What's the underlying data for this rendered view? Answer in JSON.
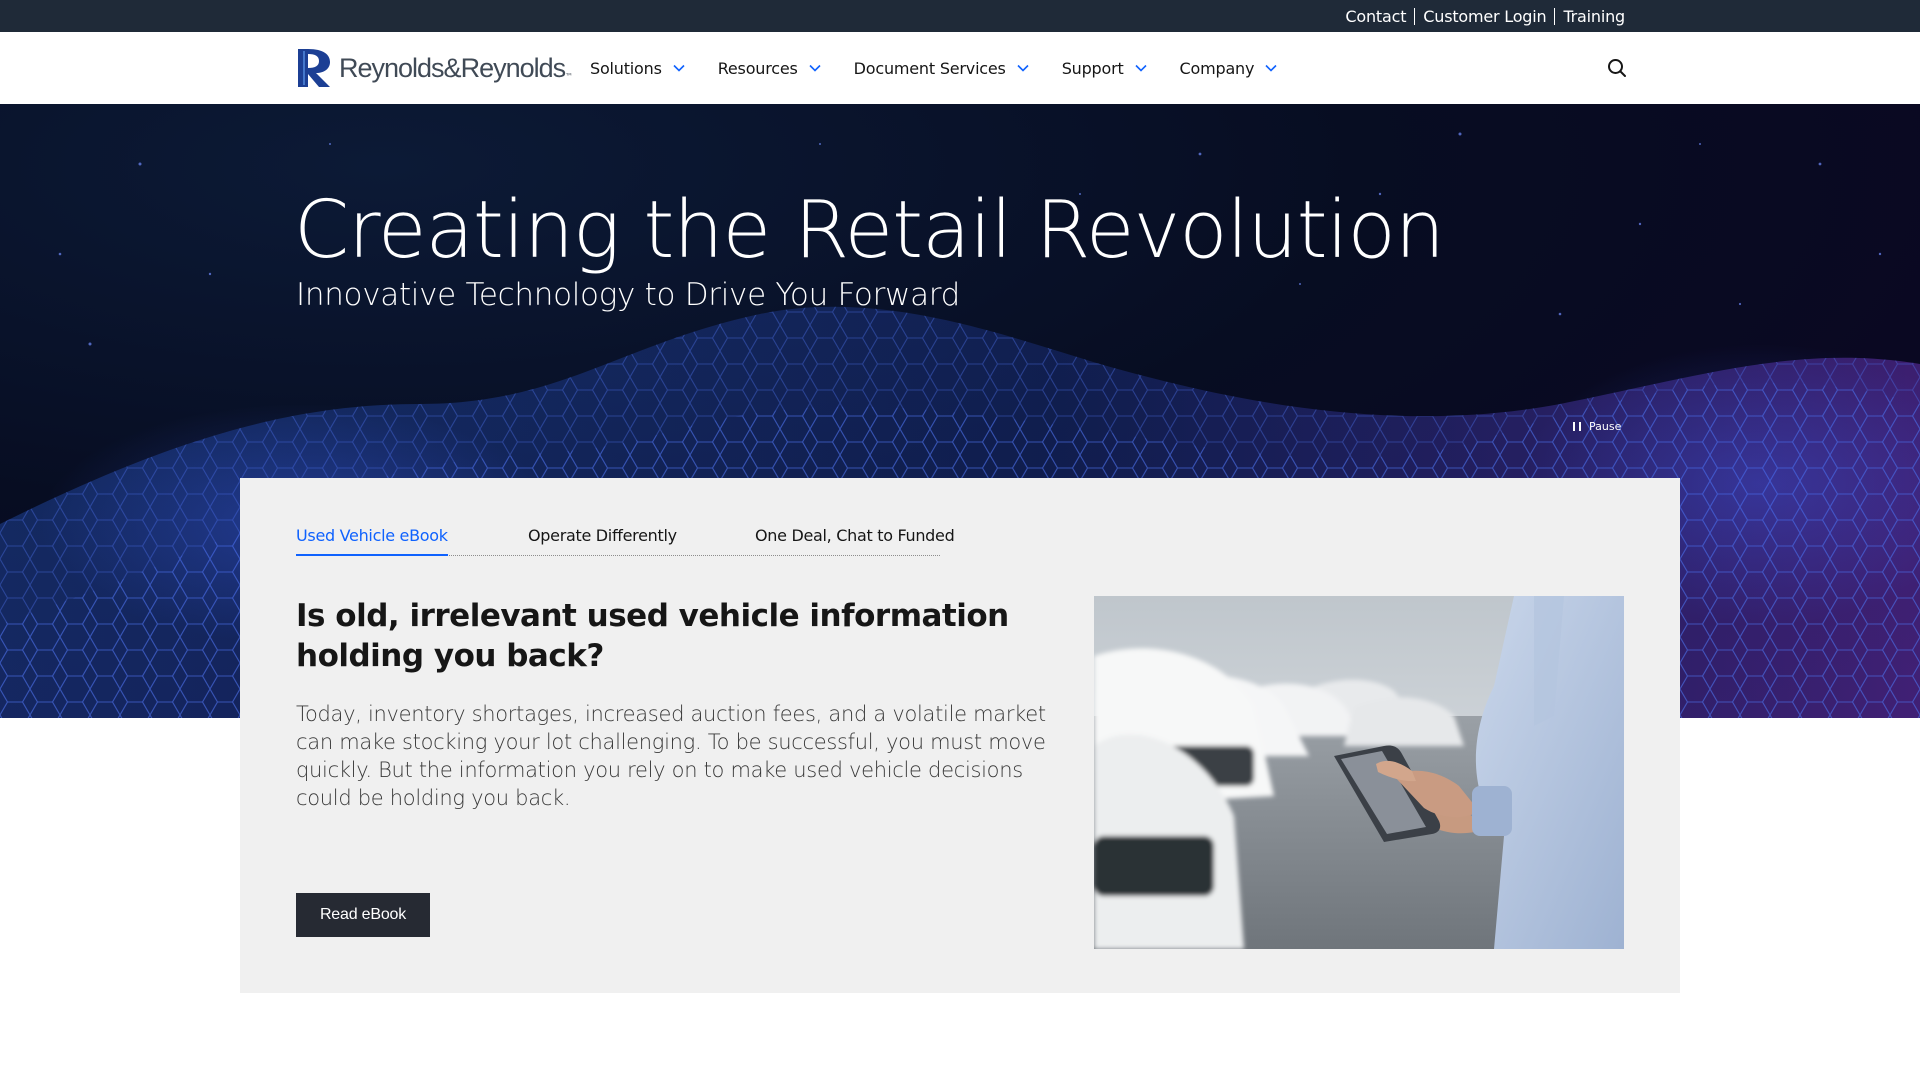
{
  "utility_nav": {
    "links": [
      "Contact",
      "Customer Login",
      "Training"
    ]
  },
  "header": {
    "logo_text": "Reynolds&Reynolds",
    "logo_tm": "™",
    "nav_items": [
      "Solutions",
      "Resources",
      "Document Services",
      "Support",
      "Company"
    ],
    "icons": {
      "search": "search-icon",
      "chevron": "chevron-down-icon"
    }
  },
  "hero": {
    "title": "Creating the Retail Revolution",
    "subtitle": "Innovative Technology to Drive You Forward",
    "pause_label": "Pause"
  },
  "feature": {
    "tabs": [
      {
        "label": "Used Vehicle eBook",
        "active": true
      },
      {
        "label": "Operate Differently",
        "active": false
      },
      {
        "label": "One Deal, Chat to Funded",
        "active": false
      }
    ],
    "heading": "Is old, irrelevant used vehicle information holding you back?",
    "body": "Today, inventory shortages, increased auction fees, and a volatile market can make stocking your lot challenging. To be successful, you must move quickly. But the information you rely on to make used vehicle decisions could be holding you back.",
    "cta_label": "Read eBook",
    "image_alt": "Person holding a tablet in a car lot"
  },
  "colors": {
    "utility_bar": "#1f2a38",
    "accent": "#0f62fe",
    "cta": "#262a33",
    "card_bg": "#f0f0f0",
    "logo_blue": "#1c3f94"
  }
}
